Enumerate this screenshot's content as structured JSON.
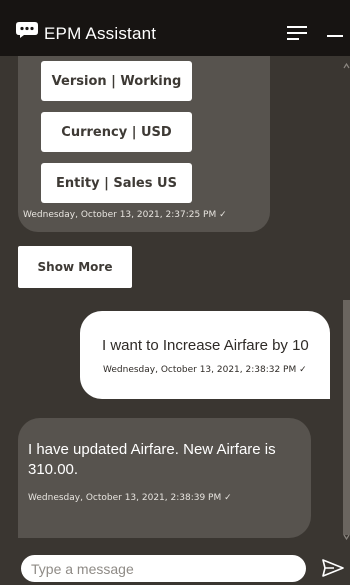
{
  "header": {
    "title": "EPM Assistant",
    "icons": {
      "logo": "chat-bubble-icon",
      "menu": "hamburger-menu-icon",
      "minimize": "minimize-icon"
    }
  },
  "messages": {
    "bot_options": {
      "options": [
        "Version | Working",
        "Currency | USD",
        "Entity | Sales US"
      ],
      "timestamp": "Wednesday, October 13, 2021, 2:37:25 PM ✓"
    },
    "show_more_label": "Show More",
    "user_message": {
      "text": "I want to Increase Airfare by 10",
      "timestamp": "Wednesday, October 13, 2021, 2:38:32 PM ✓"
    },
    "bot_reply": {
      "text": "I have updated Airfare. New  Airfare is 310.00.",
      "timestamp": "Wednesday, October 13, 2021, 2:38:39 PM ✓"
    }
  },
  "input": {
    "placeholder": "Type a message",
    "value": "",
    "send_icon": "send-icon"
  },
  "colors": {
    "header_bg": "#171412",
    "chat_bg": "#3a3631",
    "bot_bubble": "#57534e",
    "user_bubble": "#ffffff"
  }
}
